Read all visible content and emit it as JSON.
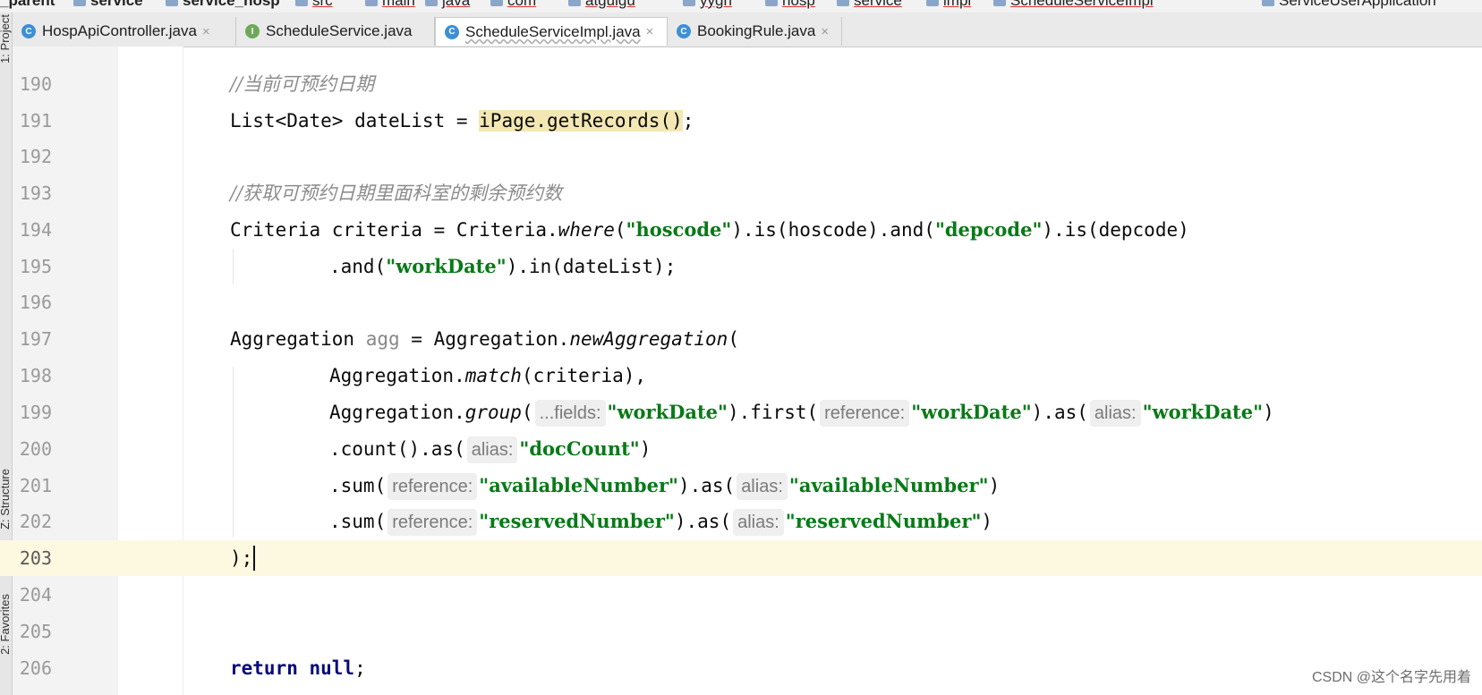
{
  "breadcrumb": [
    "_parent",
    "service",
    "service_hosp",
    "src",
    "main",
    "java",
    "com",
    "atguigu",
    "yygh",
    "hosp",
    "service",
    "impl",
    "ScheduleServiceImpl",
    "ServiceUserApplication"
  ],
  "tabs": [
    {
      "label": "HospApiController.java",
      "kind": "class",
      "active": false
    },
    {
      "label": "ScheduleService.java",
      "kind": "interface",
      "active": false
    },
    {
      "label": "ScheduleServiceImpl.java",
      "kind": "class",
      "active": true
    },
    {
      "label": "BookingRule.java",
      "kind": "class",
      "active": false
    }
  ],
  "tool_windows": {
    "project": "1: Project",
    "structure": "Z: Structure",
    "favorites": "2: Favorites"
  },
  "editor": {
    "current_line": "203",
    "lines": [
      {
        "num": "190",
        "text": "//当前可预约日期"
      },
      {
        "num": "191",
        "text": "List<Date> dateList = iPage.getRecords();"
      },
      {
        "num": "192",
        "text": ""
      },
      {
        "num": "193",
        "text": "//获取可预约日期里面科室的剩余预约数"
      },
      {
        "num": "194",
        "text": "Criteria criteria = Criteria.where(\"hoscode\").is(hoscode).and(\"depcode\").is(depcode)"
      },
      {
        "num": "195",
        "text": ".and(\"workDate\").in(dateList);"
      },
      {
        "num": "196",
        "text": ""
      },
      {
        "num": "197",
        "text": "Aggregation agg = Aggregation.newAggregation("
      },
      {
        "num": "198",
        "text": "Aggregation.match(criteria),"
      },
      {
        "num": "199",
        "text": "Aggregation.group( ...fields: \"workDate\").first( reference: \"workDate\").as( alias: \"workDate\")"
      },
      {
        "num": "200",
        "text": ".count().as( alias: \"docCount\")"
      },
      {
        "num": "201",
        "text": ".sum( reference: \"availableNumber\").as( alias: \"availableNumber\")"
      },
      {
        "num": "202",
        "text": ".sum( reference: \"reservedNumber\").as( alias: \"reservedNumber\")"
      },
      {
        "num": "203",
        "text": ");"
      },
      {
        "num": "204",
        "text": ""
      },
      {
        "num": "205",
        "text": ""
      },
      {
        "num": "206",
        "text": "return null;"
      }
    ]
  },
  "watermark": "CSDN @这个名字先用着",
  "colors": {
    "keyword": "#0a0a7a",
    "string": "#087a17",
    "comment": "#8c8c8c",
    "current_line": "#fdf8e0",
    "highlight": "#f3e7b3"
  }
}
